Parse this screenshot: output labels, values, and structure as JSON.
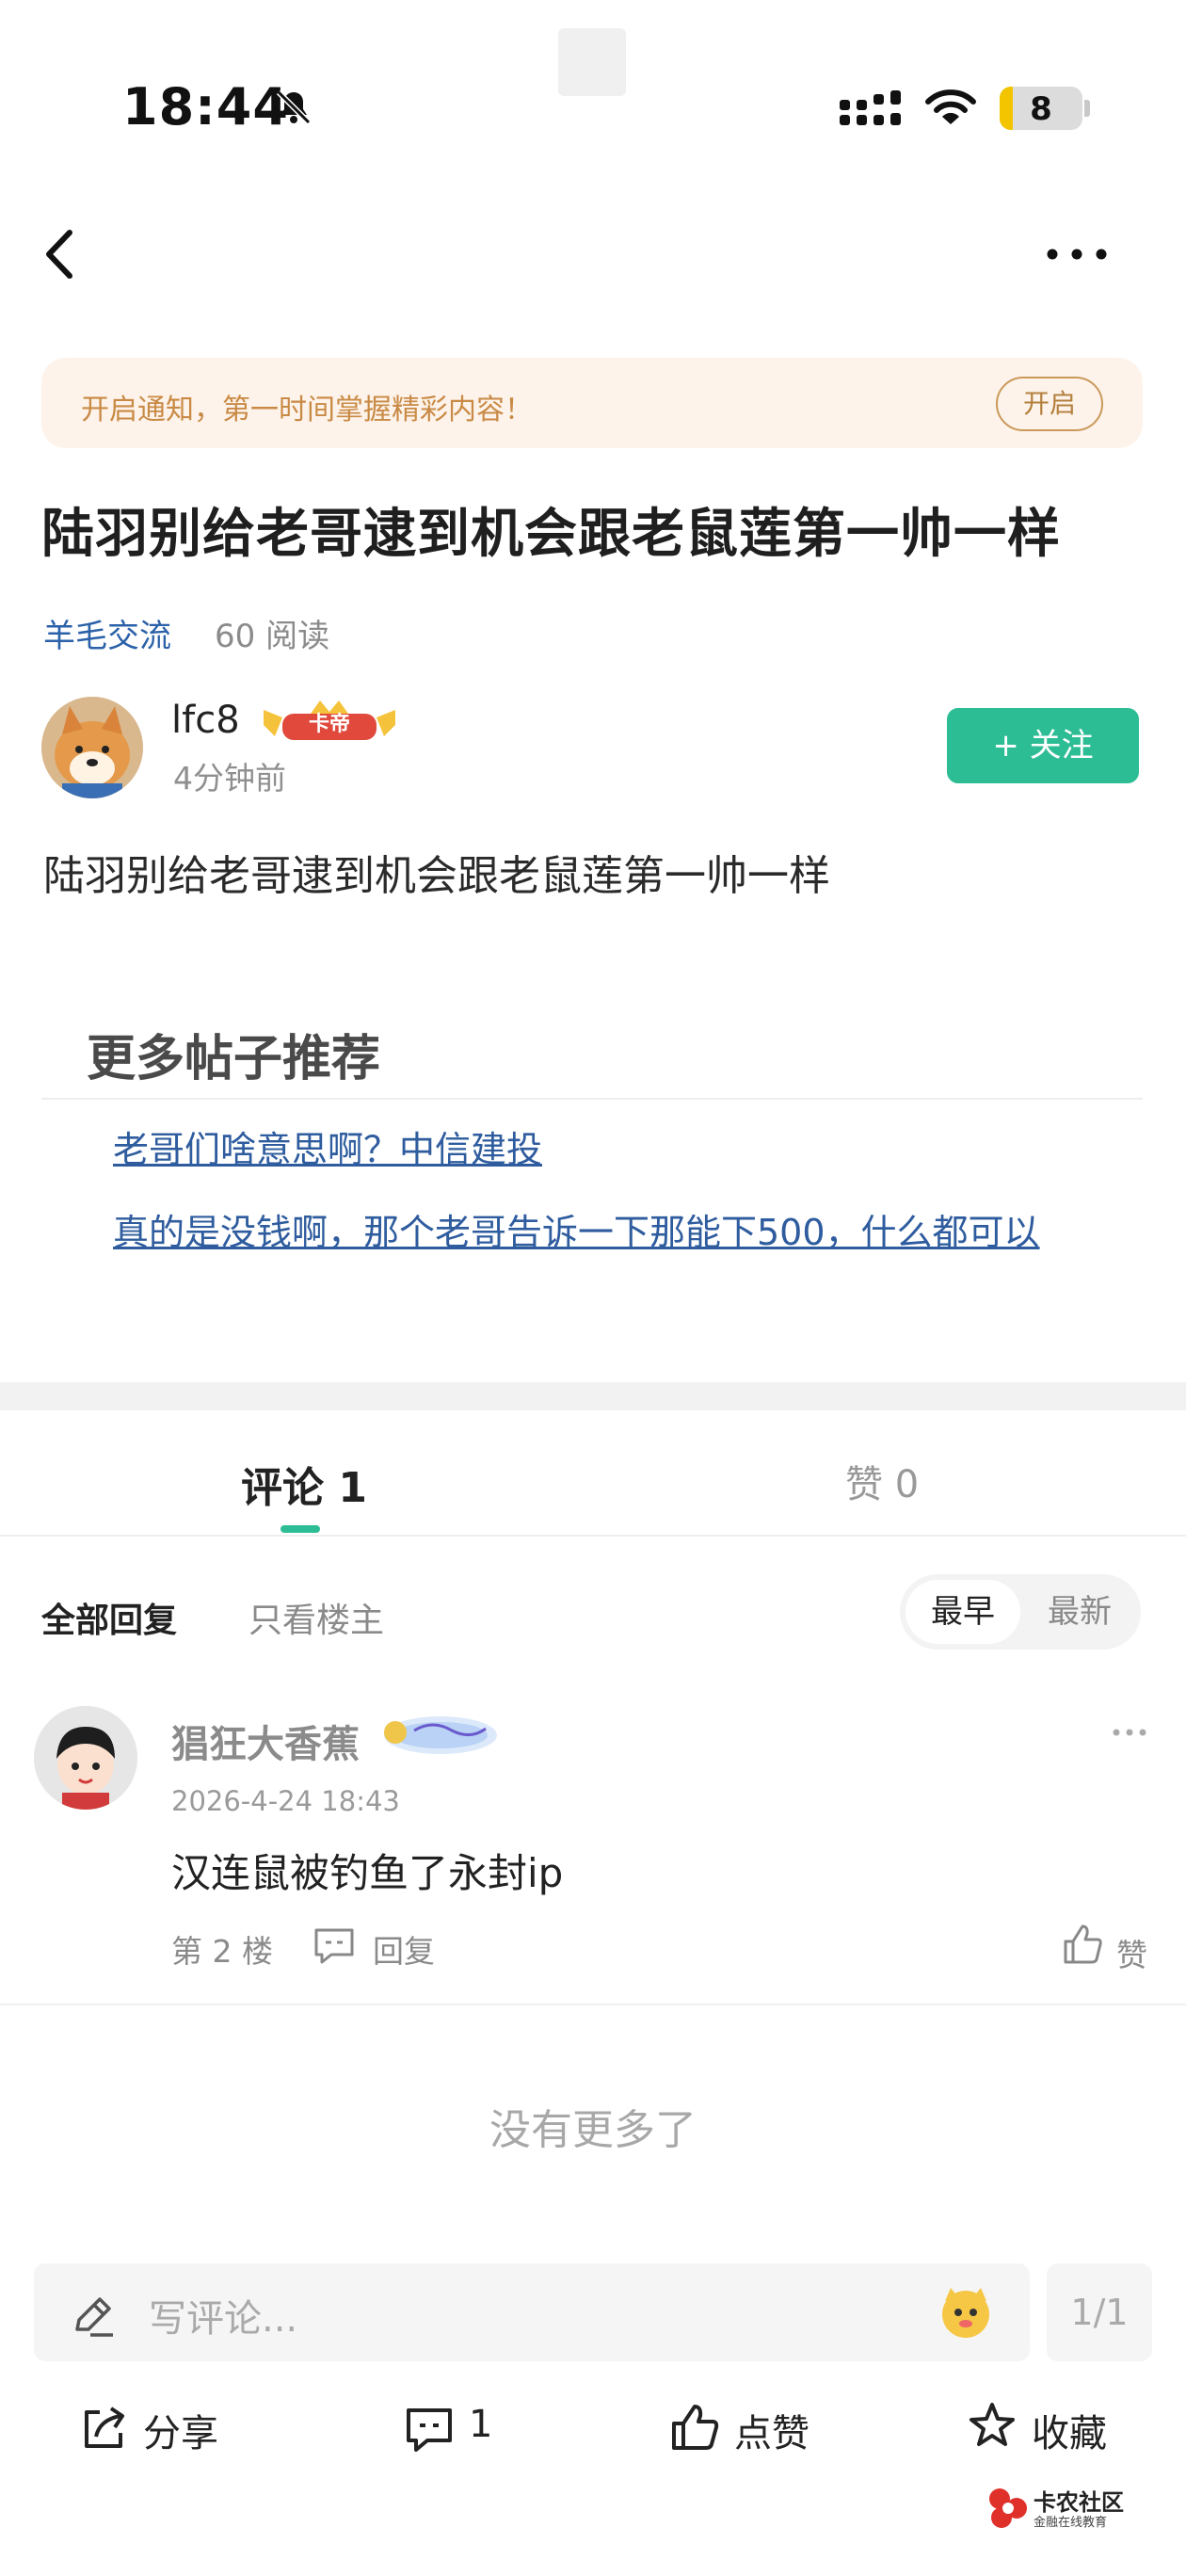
{
  "status_bar": {
    "time": "18:44",
    "battery": "8"
  },
  "notify": {
    "text": "开启通知，第一时间掌握精彩内容！",
    "button": "开启"
  },
  "post": {
    "title": "陆羽别给老哥逮到机会跟老鼠莲第一帅一样",
    "category": "羊毛交流",
    "reads": "60 阅读",
    "author": "lfc8",
    "author_badge": "卡帝",
    "time": "4分钟前",
    "follow_label": "+ 关注",
    "body": "陆羽别给老哥逮到机会跟老鼠莲第一帅一样"
  },
  "recommend": {
    "heading": "更多帖子推荐",
    "items": [
      {
        "label": "老哥们啥意思啊？中信建投"
      },
      {
        "label": "真的是没钱啊，那个老哥告诉一下那能下500，什么都可以"
      }
    ]
  },
  "tabs": {
    "comments": "评论 1",
    "likes": "赞 0"
  },
  "filters": {
    "all": "全部回复",
    "op_only": "只看楼主",
    "sort_early": "最早",
    "sort_new": "最新"
  },
  "comments": [
    {
      "name": "猖狂大香蕉",
      "time": "2026-4-24 18:43",
      "text": "汉连鼠被钓鱼了永封ip",
      "floor": "第 2 楼",
      "reply": "回复",
      "like": "赞"
    }
  ],
  "no_more": "没有更多了",
  "composer": {
    "placeholder": "写评论...",
    "page": "1/1"
  },
  "actions": {
    "share": "分享",
    "comment_count": "1",
    "like": "点赞",
    "favorite": "收藏"
  },
  "watermark": {
    "brand": "卡农社区",
    "sub": "金融在线教育"
  },
  "colors": {
    "accent": "#2dbd95",
    "link": "#2e5c9e",
    "banner_bg": "#fdf3ea"
  }
}
